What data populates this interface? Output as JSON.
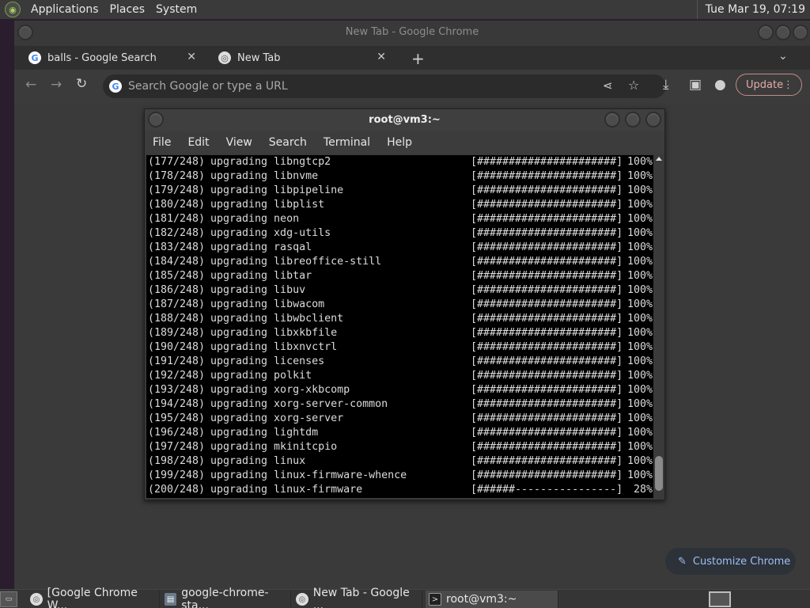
{
  "top_panel": {
    "menus": [
      "Applications",
      "Places",
      "System"
    ],
    "clock": "Tue Mar 19, 07:19"
  },
  "chrome": {
    "window_title": "New Tab - Google Chrome",
    "tabs": [
      {
        "label": "balls - Google Search",
        "icon": "google-icon"
      },
      {
        "label": "New Tab",
        "icon": "chrome-icon"
      }
    ],
    "omnibox_placeholder": "Search Google or type a URL",
    "update_label": "Update",
    "customize_label": "Customize Chrome"
  },
  "terminal": {
    "title": "root@vm3:~",
    "menu": [
      "File",
      "Edit",
      "View",
      "Search",
      "Terminal",
      "Help"
    ],
    "lines": [
      {
        "idx": "(177/248)",
        "text": "upgrading libngtcp2",
        "bar": "[######################]",
        "pct": "100%"
      },
      {
        "idx": "(178/248)",
        "text": "upgrading libnvme",
        "bar": "[######################]",
        "pct": "100%"
      },
      {
        "idx": "(179/248)",
        "text": "upgrading libpipeline",
        "bar": "[######################]",
        "pct": "100%"
      },
      {
        "idx": "(180/248)",
        "text": "upgrading libplist",
        "bar": "[######################]",
        "pct": "100%"
      },
      {
        "idx": "(181/248)",
        "text": "upgrading neon",
        "bar": "[######################]",
        "pct": "100%"
      },
      {
        "idx": "(182/248)",
        "text": "upgrading xdg-utils",
        "bar": "[######################]",
        "pct": "100%"
      },
      {
        "idx": "(183/248)",
        "text": "upgrading rasqal",
        "bar": "[######################]",
        "pct": "100%"
      },
      {
        "idx": "(184/248)",
        "text": "upgrading libreoffice-still",
        "bar": "[######################]",
        "pct": "100%"
      },
      {
        "idx": "(185/248)",
        "text": "upgrading libtar",
        "bar": "[######################]",
        "pct": "100%"
      },
      {
        "idx": "(186/248)",
        "text": "upgrading libuv",
        "bar": "[######################]",
        "pct": "100%"
      },
      {
        "idx": "(187/248)",
        "text": "upgrading libwacom",
        "bar": "[######################]",
        "pct": "100%"
      },
      {
        "idx": "(188/248)",
        "text": "upgrading libwbclient",
        "bar": "[######################]",
        "pct": "100%"
      },
      {
        "idx": "(189/248)",
        "text": "upgrading libxkbfile",
        "bar": "[######################]",
        "pct": "100%"
      },
      {
        "idx": "(190/248)",
        "text": "upgrading libxnvctrl",
        "bar": "[######################]",
        "pct": "100%"
      },
      {
        "idx": "(191/248)",
        "text": "upgrading licenses",
        "bar": "[######################]",
        "pct": "100%"
      },
      {
        "idx": "(192/248)",
        "text": "upgrading polkit",
        "bar": "[######################]",
        "pct": "100%"
      },
      {
        "idx": "(193/248)",
        "text": "upgrading xorg-xkbcomp",
        "bar": "[######################]",
        "pct": "100%"
      },
      {
        "idx": "(194/248)",
        "text": "upgrading xorg-server-common",
        "bar": "[######################]",
        "pct": "100%"
      },
      {
        "idx": "(195/248)",
        "text": "upgrading xorg-server",
        "bar": "[######################]",
        "pct": "100%"
      },
      {
        "idx": "(196/248)",
        "text": "upgrading lightdm",
        "bar": "[######################]",
        "pct": "100%"
      },
      {
        "idx": "(197/248)",
        "text": "upgrading mkinitcpio",
        "bar": "[######################]",
        "pct": "100%"
      },
      {
        "idx": "(198/248)",
        "text": "upgrading linux",
        "bar": "[######################]",
        "pct": "100%"
      },
      {
        "idx": "(199/248)",
        "text": "upgrading linux-firmware-whence",
        "bar": "[######################]",
        "pct": "100%"
      },
      {
        "idx": "(200/248)",
        "text": "upgrading linux-firmware",
        "bar": "[######----------------]",
        "pct": "28%"
      }
    ]
  },
  "taskbar": {
    "tasks": [
      {
        "label": "[Google Chrome W...",
        "icon": "chrome-icon"
      },
      {
        "label": "google-chrome-sta...",
        "icon": "folder-icon"
      },
      {
        "label": "New Tab - Google ...",
        "icon": "chrome-icon"
      },
      {
        "label": "root@vm3:~",
        "icon": "terminal-icon"
      }
    ]
  },
  "colors": {
    "terminal_bg": "#000000",
    "update_accent": "#e7a8a8",
    "customize_accent": "#9cc0f5"
  }
}
